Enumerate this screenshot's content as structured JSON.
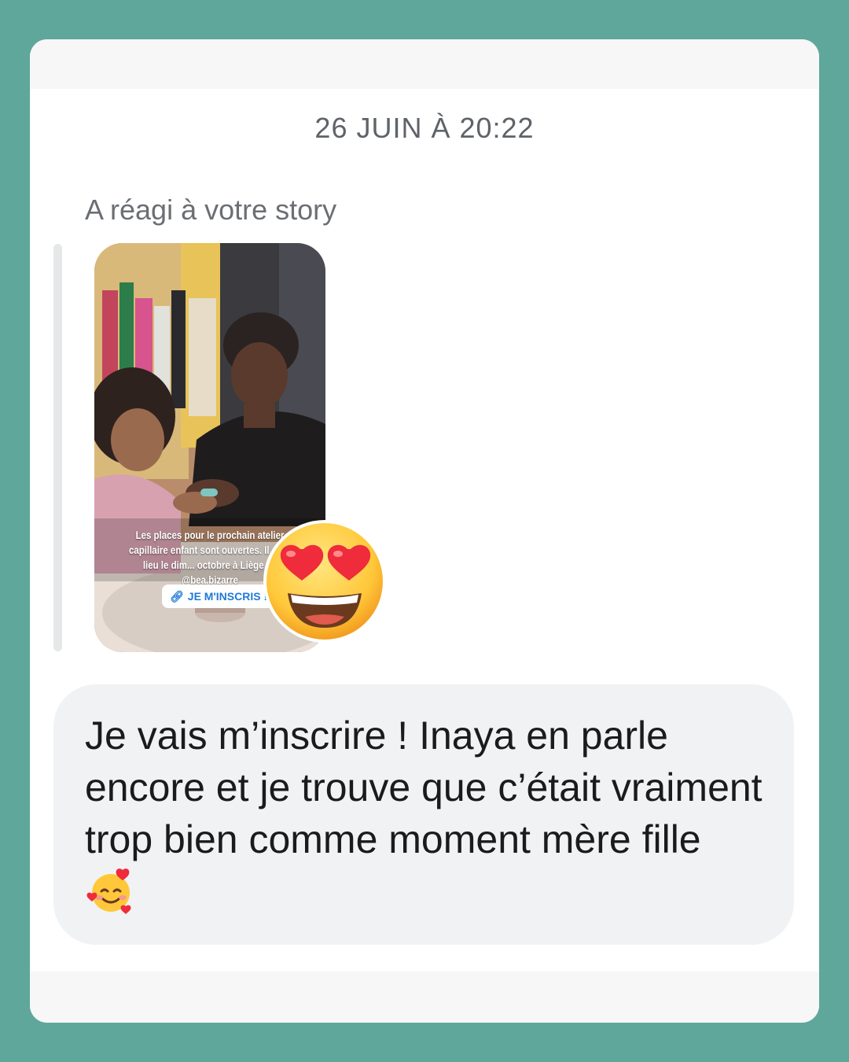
{
  "thread": {
    "timestamp": "26 JUIN À 20:22",
    "reaction_label": "A réagi à votre story"
  },
  "story": {
    "caption": "Les places pour le prochain atelier capillaire enfant sont ouvertes. Il aura lieu le dim... octobre à Liège au @bea.bizarre",
    "link_sticker_label": "JE M'INSCRIS !",
    "link_icon": "link-icon"
  },
  "reaction": {
    "emoji": "heart-eyes-emoji"
  },
  "message": {
    "text": "Je vais m’inscrire ! Inaya en parle encore et je trouve que c’était vraiment trop bien comme moment mère fille",
    "trailing_emoji": "smiling-face-with-hearts-emoji"
  },
  "colors": {
    "frame": "#5fa79a",
    "card": "#ffffff",
    "bubble": "#f1f2f4",
    "muted_text": "#5f6368"
  }
}
